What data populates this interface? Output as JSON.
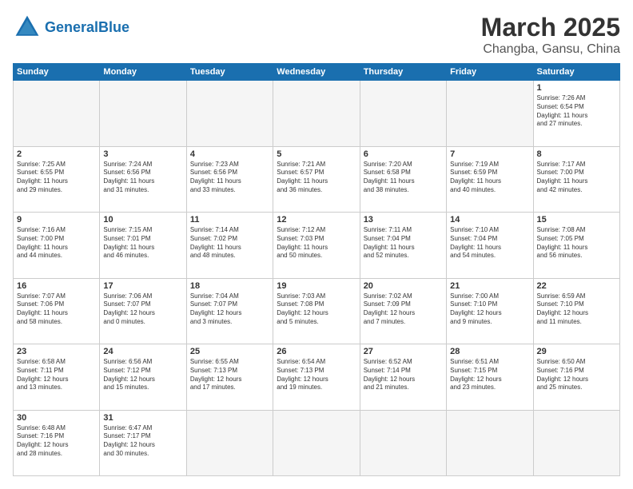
{
  "header": {
    "logo_general": "General",
    "logo_blue": "Blue",
    "month": "March 2025",
    "location": "Changba, Gansu, China"
  },
  "weekdays": [
    "Sunday",
    "Monday",
    "Tuesday",
    "Wednesday",
    "Thursday",
    "Friday",
    "Saturday"
  ],
  "weeks": [
    [
      {
        "day": "",
        "info": ""
      },
      {
        "day": "",
        "info": ""
      },
      {
        "day": "",
        "info": ""
      },
      {
        "day": "",
        "info": ""
      },
      {
        "day": "",
        "info": ""
      },
      {
        "day": "",
        "info": ""
      },
      {
        "day": "1",
        "info": "Sunrise: 7:26 AM\nSunset: 6:54 PM\nDaylight: 11 hours\nand 27 minutes."
      }
    ],
    [
      {
        "day": "2",
        "info": "Sunrise: 7:25 AM\nSunset: 6:55 PM\nDaylight: 11 hours\nand 29 minutes."
      },
      {
        "day": "3",
        "info": "Sunrise: 7:24 AM\nSunset: 6:56 PM\nDaylight: 11 hours\nand 31 minutes."
      },
      {
        "day": "4",
        "info": "Sunrise: 7:23 AM\nSunset: 6:56 PM\nDaylight: 11 hours\nand 33 minutes."
      },
      {
        "day": "5",
        "info": "Sunrise: 7:21 AM\nSunset: 6:57 PM\nDaylight: 11 hours\nand 36 minutes."
      },
      {
        "day": "6",
        "info": "Sunrise: 7:20 AM\nSunset: 6:58 PM\nDaylight: 11 hours\nand 38 minutes."
      },
      {
        "day": "7",
        "info": "Sunrise: 7:19 AM\nSunset: 6:59 PM\nDaylight: 11 hours\nand 40 minutes."
      },
      {
        "day": "8",
        "info": "Sunrise: 7:17 AM\nSunset: 7:00 PM\nDaylight: 11 hours\nand 42 minutes."
      }
    ],
    [
      {
        "day": "9",
        "info": "Sunrise: 7:16 AM\nSunset: 7:00 PM\nDaylight: 11 hours\nand 44 minutes."
      },
      {
        "day": "10",
        "info": "Sunrise: 7:15 AM\nSunset: 7:01 PM\nDaylight: 11 hours\nand 46 minutes."
      },
      {
        "day": "11",
        "info": "Sunrise: 7:14 AM\nSunset: 7:02 PM\nDaylight: 11 hours\nand 48 minutes."
      },
      {
        "day": "12",
        "info": "Sunrise: 7:12 AM\nSunset: 7:03 PM\nDaylight: 11 hours\nand 50 minutes."
      },
      {
        "day": "13",
        "info": "Sunrise: 7:11 AM\nSunset: 7:04 PM\nDaylight: 11 hours\nand 52 minutes."
      },
      {
        "day": "14",
        "info": "Sunrise: 7:10 AM\nSunset: 7:04 PM\nDaylight: 11 hours\nand 54 minutes."
      },
      {
        "day": "15",
        "info": "Sunrise: 7:08 AM\nSunset: 7:05 PM\nDaylight: 11 hours\nand 56 minutes."
      }
    ],
    [
      {
        "day": "16",
        "info": "Sunrise: 7:07 AM\nSunset: 7:06 PM\nDaylight: 11 hours\nand 58 minutes."
      },
      {
        "day": "17",
        "info": "Sunrise: 7:06 AM\nSunset: 7:07 PM\nDaylight: 12 hours\nand 0 minutes."
      },
      {
        "day": "18",
        "info": "Sunrise: 7:04 AM\nSunset: 7:07 PM\nDaylight: 12 hours\nand 3 minutes."
      },
      {
        "day": "19",
        "info": "Sunrise: 7:03 AM\nSunset: 7:08 PM\nDaylight: 12 hours\nand 5 minutes."
      },
      {
        "day": "20",
        "info": "Sunrise: 7:02 AM\nSunset: 7:09 PM\nDaylight: 12 hours\nand 7 minutes."
      },
      {
        "day": "21",
        "info": "Sunrise: 7:00 AM\nSunset: 7:10 PM\nDaylight: 12 hours\nand 9 minutes."
      },
      {
        "day": "22",
        "info": "Sunrise: 6:59 AM\nSunset: 7:10 PM\nDaylight: 12 hours\nand 11 minutes."
      }
    ],
    [
      {
        "day": "23",
        "info": "Sunrise: 6:58 AM\nSunset: 7:11 PM\nDaylight: 12 hours\nand 13 minutes."
      },
      {
        "day": "24",
        "info": "Sunrise: 6:56 AM\nSunset: 7:12 PM\nDaylight: 12 hours\nand 15 minutes."
      },
      {
        "day": "25",
        "info": "Sunrise: 6:55 AM\nSunset: 7:13 PM\nDaylight: 12 hours\nand 17 minutes."
      },
      {
        "day": "26",
        "info": "Sunrise: 6:54 AM\nSunset: 7:13 PM\nDaylight: 12 hours\nand 19 minutes."
      },
      {
        "day": "27",
        "info": "Sunrise: 6:52 AM\nSunset: 7:14 PM\nDaylight: 12 hours\nand 21 minutes."
      },
      {
        "day": "28",
        "info": "Sunrise: 6:51 AM\nSunset: 7:15 PM\nDaylight: 12 hours\nand 23 minutes."
      },
      {
        "day": "29",
        "info": "Sunrise: 6:50 AM\nSunset: 7:16 PM\nDaylight: 12 hours\nand 25 minutes."
      }
    ],
    [
      {
        "day": "30",
        "info": "Sunrise: 6:48 AM\nSunset: 7:16 PM\nDaylight: 12 hours\nand 28 minutes."
      },
      {
        "day": "31",
        "info": "Sunrise: 6:47 AM\nSunset: 7:17 PM\nDaylight: 12 hours\nand 30 minutes."
      },
      {
        "day": "",
        "info": ""
      },
      {
        "day": "",
        "info": ""
      },
      {
        "day": "",
        "info": ""
      },
      {
        "day": "",
        "info": ""
      },
      {
        "day": "",
        "info": ""
      }
    ]
  ]
}
